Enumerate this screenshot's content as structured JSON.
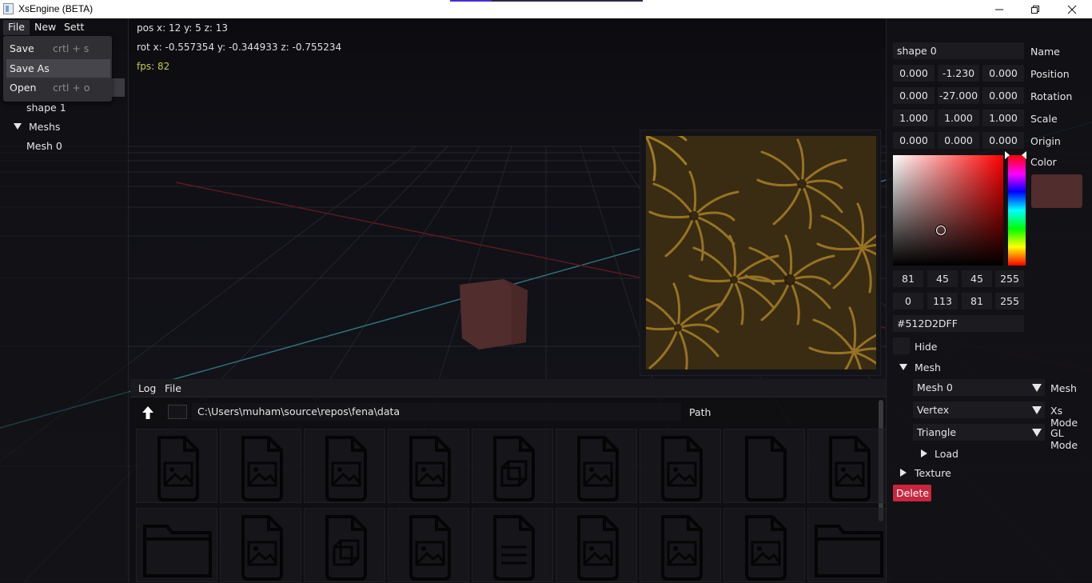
{
  "window": {
    "title": "XsEngine (BETA)"
  },
  "menubar": {
    "file": "File",
    "new": "New",
    "settings": "Sett"
  },
  "file_menu": [
    {
      "label": "Save",
      "shortcut": "crtl + s"
    },
    {
      "label": "Save As",
      "shortcut": ""
    },
    {
      "label": "Open",
      "shortcut": "crtl + o"
    }
  ],
  "scene_tree": {
    "shape1": "shape 1",
    "meshs": "Meshs",
    "mesh0": "Mesh 0"
  },
  "overlay": {
    "pos": "pos x: 12 y: 5 z: 13",
    "rot": "rot x: -0.557354 y: -0.344933 z: -0.755234",
    "fps": "fps: 82"
  },
  "bottom": {
    "menu_log": "Log",
    "menu_file": "File",
    "path": "C:\\Users\\muham\\source\\repos\\fena\\data",
    "path_label": "Path"
  },
  "files_row1": [
    "image-file-icon",
    "image-file-icon",
    "image-file-icon",
    "image-file-icon",
    "model-file-icon",
    "image-file-icon",
    "image-file-icon",
    "blank-file-icon",
    "image-file-icon"
  ],
  "files_row2": [
    "folder-icon",
    "image-file-icon",
    "model-file-icon",
    "image-file-icon",
    "text-file-icon",
    "image-file-icon",
    "image-file-icon",
    "image-file-icon",
    "folder-icon"
  ],
  "inspector": {
    "name_value": "shape 0",
    "name_label": "Name",
    "position": [
      "0.000",
      "-1.230",
      "0.000"
    ],
    "position_label": "Position",
    "rotation": [
      "0.000",
      "-27.000",
      "0.000"
    ],
    "rotation_label": "Rotation",
    "scale": [
      "1.000",
      "1.000",
      "1.000"
    ],
    "scale_label": "Scale",
    "origin": [
      "0.000",
      "0.000",
      "0.000"
    ],
    "origin_label": "Origin",
    "color_label": "Color",
    "rgba": [
      "81",
      "45",
      "45",
      "255"
    ],
    "hsva": [
      "0",
      "113",
      "81",
      "255"
    ],
    "hex": "#512D2DFF",
    "hide_label": "Hide",
    "mesh_section": "Mesh",
    "mesh_value": "Mesh 0",
    "mesh_label": "Mesh",
    "xs_mode_value": "Vertex",
    "xs_mode_label": "Xs Mode",
    "gl_mode_value": "Triangle",
    "gl_mode_label": "GL Mode",
    "load_label": "Load",
    "texture_section": "Texture",
    "delete_label": "Delete"
  },
  "colors": {
    "object_color": "#512D2D",
    "delete": "#c8263f",
    "fps": "#c9c94a"
  }
}
